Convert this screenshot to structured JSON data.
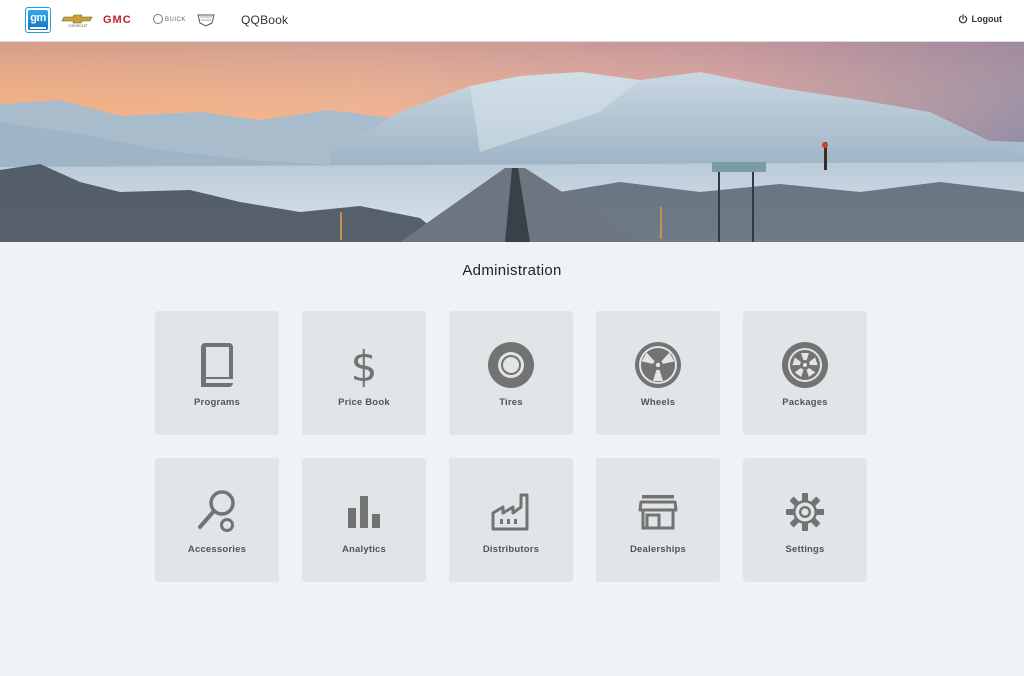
{
  "header": {
    "logo_text": "gm",
    "brands": [
      "CHEVROLET",
      "GMC",
      "BUICK",
      "CADILLAC"
    ],
    "app_title": "QQBook",
    "logout_label": "Logout"
  },
  "banner": {
    "alt": "Snowy mountain road at sunset"
  },
  "main": {
    "title": "Administration",
    "tiles": [
      {
        "label": "Programs",
        "icon": "book-icon"
      },
      {
        "label": "Price Book",
        "icon": "dollar-icon"
      },
      {
        "label": "Tires",
        "icon": "tire-icon"
      },
      {
        "label": "Wheels",
        "icon": "wheel-icon"
      },
      {
        "label": "Packages",
        "icon": "package-wheel-icon"
      },
      {
        "label": "Accessories",
        "icon": "accessory-icon"
      },
      {
        "label": "Analytics",
        "icon": "bar-chart-icon"
      },
      {
        "label": "Distributors",
        "icon": "factory-icon"
      },
      {
        "label": "Dealerships",
        "icon": "store-icon"
      },
      {
        "label": "Settings",
        "icon": "gear-icon"
      }
    ]
  },
  "colors": {
    "page_bg": "#eff3f6",
    "tile_bg": "#e0e5e8",
    "icon": "#737373",
    "accent": "#1e9ee0"
  }
}
